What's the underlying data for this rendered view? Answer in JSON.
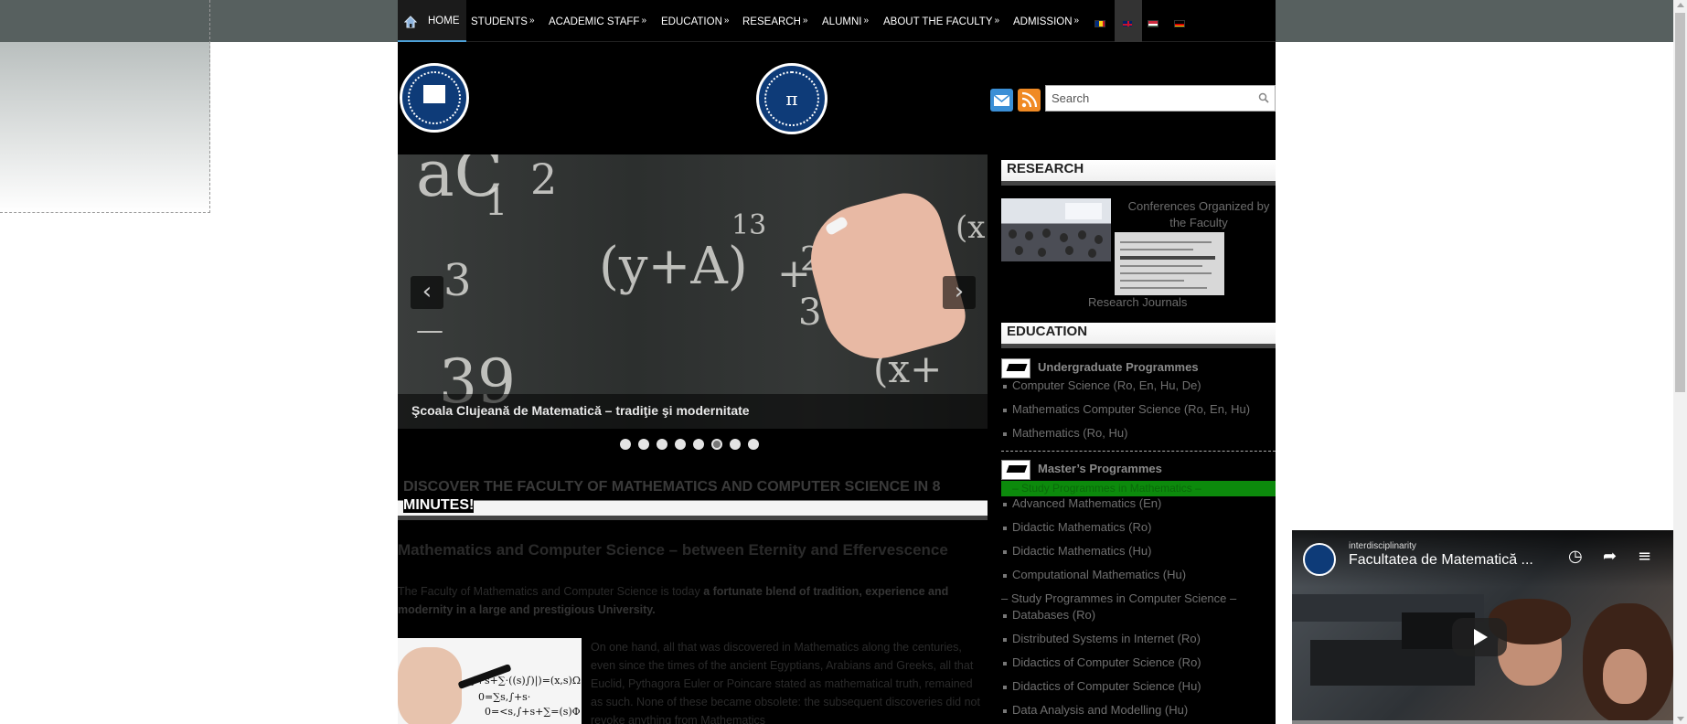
{
  "nav": {
    "items": [
      {
        "label": "HOME",
        "arrow": ""
      },
      {
        "label": "STUDENTS",
        "arrow": "»"
      },
      {
        "label": "ACADEMIC STAFF",
        "arrow": "»"
      },
      {
        "label": "EDUCATION",
        "arrow": "»"
      },
      {
        "label": "RESEARCH",
        "arrow": "»"
      },
      {
        "label": "ALUMNI",
        "arrow": "»"
      },
      {
        "label": "ABOUT THE FACULTY",
        "arrow": "»"
      },
      {
        "label": "ADMISSION",
        "arrow": "»"
      }
    ],
    "languages": [
      "ro",
      "en",
      "hu",
      "de"
    ],
    "active_language": "en"
  },
  "header": {
    "icons": [
      "email-icon",
      "rss-icon"
    ],
    "search": {
      "placeholder": "Search"
    }
  },
  "slider": {
    "caption": "Şcoala Clujeană de Matematică – tradiţie şi modernitate",
    "prev_symbol": "‹",
    "next_symbol": "›",
    "slide_count": 8,
    "active_index": 5
  },
  "main": {
    "discover_heading_part1": "DISCOVER THE FACULTY OF MATHEMATICS AND COMPUTER SCIENCE IN 8",
    "discover_heading_part2": "MINUTES!",
    "article_title": "Mathematics and Computer Science – between Eternity and Effervescence",
    "p1_normal": "The Faculty of Mathematics and Computer Science is today ",
    "p1_bold": "a fortunate blend of tradition, experience and modernity in a large and prestigious University.",
    "p2": "On one hand, all that was discovered in Mathematics along the centuries, even since the times of the ancient Egyptians, Arabians and Greeks, all that Euclid, Pythagora Euler or Poincare stated as mathematical truth, remained as such. None of these became obsolete: the subsequent discoveries did not revoke anything from Mathematics"
  },
  "sidebar": {
    "research_heading": "RESEARCH",
    "research_links": [
      "Conferences Organized by the Faculty",
      "Research Journals"
    ],
    "education_heading": "EDUCATION",
    "undergrad_heading": "Undergraduate Programmes",
    "undergrad_items": [
      "Computer Science (Ro, En, Hu, De)",
      "Mathematics Computer Science (Ro, En, Hu)",
      "Mathematics (Ro, Hu)"
    ],
    "masters_heading": "Master’s Programmes",
    "masters_highlight": "– Study Programmes in Mathematics –",
    "masters_items": [
      "Advanced Mathematics (En)",
      "Didactic Mathematics (Ro)",
      "Didactic Mathematics (Hu)",
      "Computational Mathematics (Hu)"
    ],
    "cs_heading_line1": "– Study Programmes in Computer Science –",
    "cs_heading_line2": "Databases (Ro)",
    "cs_items": [
      "Distributed Systems in Internet (Ro)",
      "Didactics of Computer Science (Ro)",
      "Didactics of Computer Science (Hu)",
      "Data Analysis and Modelling (Hu)"
    ]
  },
  "video": {
    "channel": "interdisciplinarity",
    "title": "Facultatea de Matematică ...",
    "controls": [
      "clock-icon",
      "share-icon",
      "playlist-icon"
    ]
  },
  "colors": {
    "page_bg": "#000000",
    "top_bar": "#57605f",
    "green_highlight": "#0c8a0c",
    "logo_blue": "#0e3b78"
  }
}
